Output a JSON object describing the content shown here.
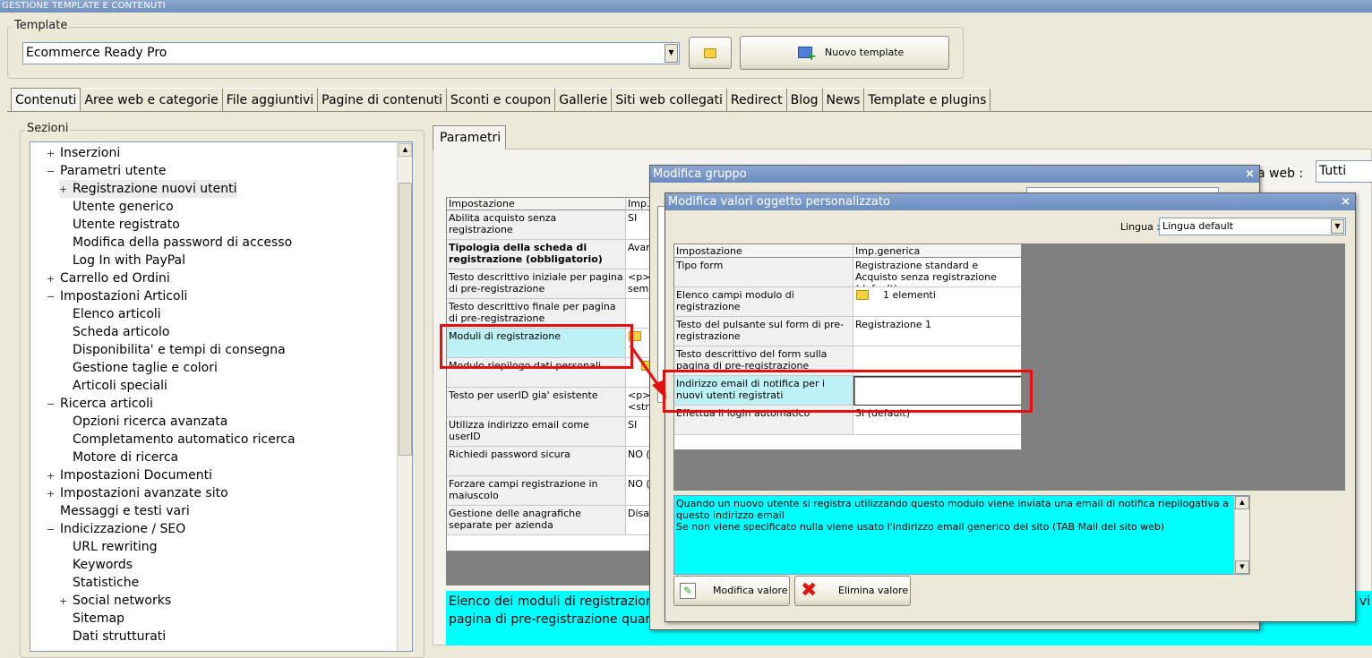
{
  "window": {
    "title": "GESTIONE TEMPLATE E CONTENUTI"
  },
  "template": {
    "group_label": "Template",
    "selected": "Ecommerce Ready Pro",
    "new_button": "Nuovo template"
  },
  "tabs": [
    {
      "label": "Contenuti"
    },
    {
      "label": "Aree web e categorie"
    },
    {
      "label": "File aggiuntivi"
    },
    {
      "label": "Pagine di contenuti"
    },
    {
      "label": "Sconti e coupon"
    },
    {
      "label": "Gallerie"
    },
    {
      "label": "Siti web collegati"
    },
    {
      "label": "Redirect"
    },
    {
      "label": "Blog"
    },
    {
      "label": "News"
    },
    {
      "label": "Template e plugins"
    }
  ],
  "sections": {
    "label": "Sezioni",
    "items": [
      {
        "label": "Inserzioni",
        "exp": "+"
      },
      {
        "label": "Parametri utente",
        "exp": "−"
      },
      {
        "label": "Registrazione nuovi utenti",
        "exp": "+"
      },
      {
        "label": "Utente generico",
        "exp": ""
      },
      {
        "label": "Utente registrato",
        "exp": ""
      },
      {
        "label": "Modifica della password di accesso",
        "exp": ""
      },
      {
        "label": "Log In with PayPal",
        "exp": ""
      },
      {
        "label": "Carrello ed Ordini",
        "exp": "+"
      },
      {
        "label": "Impostazioni Articoli",
        "exp": "−"
      },
      {
        "label": "Elenco articoli",
        "exp": ""
      },
      {
        "label": "Scheda articolo",
        "exp": ""
      },
      {
        "label": "Disponibilita' e tempi di consegna",
        "exp": ""
      },
      {
        "label": "Gestione taglie e colori",
        "exp": ""
      },
      {
        "label": "Articoli speciali",
        "exp": ""
      },
      {
        "label": "Ricerca articoli",
        "exp": "−"
      },
      {
        "label": "Opzioni ricerca avanzata",
        "exp": ""
      },
      {
        "label": "Completamento automatico ricerca",
        "exp": ""
      },
      {
        "label": "Motore di ricerca",
        "exp": ""
      },
      {
        "label": "Impostazioni Documenti",
        "exp": "+"
      },
      {
        "label": "Impostazioni avanzate sito",
        "exp": "+"
      },
      {
        "label": "Messaggi e testi vari",
        "exp": ""
      },
      {
        "label": "Indicizzazione / SEO",
        "exp": "−"
      },
      {
        "label": "URL rewriting",
        "exp": ""
      },
      {
        "label": "Keywords",
        "exp": ""
      },
      {
        "label": "Statistiche",
        "exp": ""
      },
      {
        "label": "Social networks",
        "exp": "+"
      },
      {
        "label": "Sitemap",
        "exp": ""
      },
      {
        "label": "Dati strutturati",
        "exp": ""
      }
    ]
  },
  "params": {
    "tab_label": "Parametri",
    "site_label": "a web :",
    "site_value": "Tutti",
    "col_setting": "Impostazione",
    "col_value": "Imp.g",
    "rows": [
      {
        "label": "Abilita acquisto senza registrazione",
        "value": "SI"
      },
      {
        "label": "Tipologia della scheda di registrazione (obbligatorio)",
        "value": "Avan"
      },
      {
        "label": "Testo descrittivo iniziale per pagina di pre-registrazione",
        "value": "<p>l\nsemp"
      },
      {
        "label": "Testo descrittivo finale per pagina di pre-registrazione",
        "value": ""
      },
      {
        "label": "Moduli di registrazione",
        "value": ""
      },
      {
        "label": "Modulo riepilogo dati personali",
        "value": ""
      },
      {
        "label": "Testo per userID gia' esistente",
        "value": "<p>\n<str"
      },
      {
        "label": "Utilizza indirizzo email come userID",
        "value": "SI"
      },
      {
        "label": "Richiedi password sicura",
        "value": "NO ("
      },
      {
        "label": "Forzare campi registrazione in maiuscolo",
        "value": "NO ("
      },
      {
        "label": "Gestione delle anagrafiche separate per azienda",
        "value": "Disat"
      }
    ],
    "description": "Elenco dei moduli di registrazione de",
    "description2": "pagina di pre-registrazione quando",
    "description_right": "' vi"
  },
  "dialog_group": {
    "title": "Modifica gruppo",
    "close": "×"
  },
  "dialog_obj": {
    "title": "Modifica valori oggetto personalizzato",
    "close": "×",
    "language_label": "Lingua :",
    "language_value": "Lingua default",
    "col_setting": "Impostazione",
    "col_value": "Imp.generica",
    "rows": [
      {
        "label": "Tipo form",
        "value": "Registrazione standard e Acquisto senza registrazione (default)"
      },
      {
        "label": "Elenco campi modulo di registrazione",
        "value": "1 elementi"
      },
      {
        "label": "Testo del pulsante sul form di pre-registrazione",
        "value": "Registrazione 1"
      },
      {
        "label": "Testo descrittivo del form sulla pagina di pre-registrazione",
        "value": ""
      },
      {
        "label": "Indirizzo email di notifica per i nuovi utenti registrati",
        "value": ""
      },
      {
        "label": "Effettua il login automatico",
        "value": "SI (default)"
      }
    ],
    "help_text": "Quando un nuovo utente si registra utilizzando questo modulo viene inviata una email di notifica riepilogativa a questo indirizzo email",
    "help_text2": "Se non viene specificato nulla viene usato l'indirizzo email generico del sito (TAB Mail del sito web)",
    "edit_button": "Modifica valore",
    "delete_button": "Elimina valore"
  },
  "colors": {
    "accent_cyan": "#00ffff",
    "highlight_row": "#bdf1f5",
    "annotation_red": "#e41010"
  }
}
